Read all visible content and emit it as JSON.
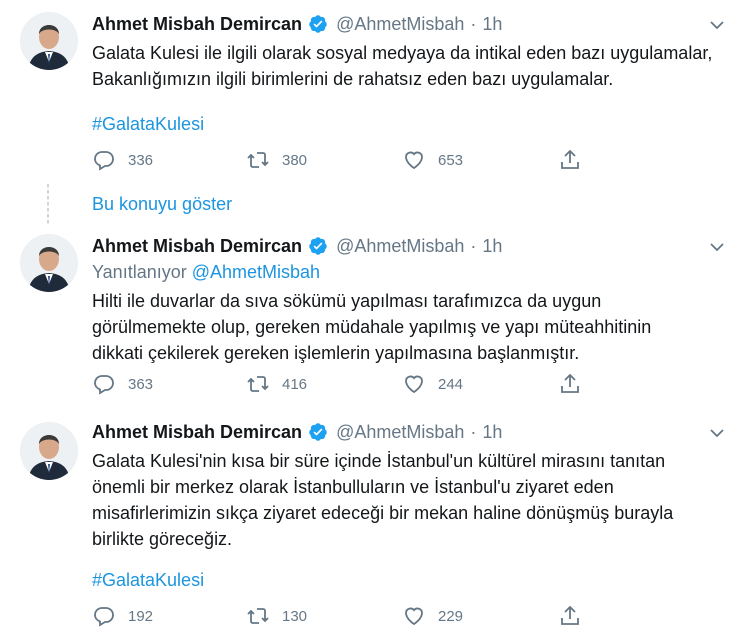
{
  "colors": {
    "accent": "#1b95e0",
    "muted": "#657786",
    "text": "#14171a",
    "verified": "#1da1f2",
    "thread_line": "#ccd6dd"
  },
  "show_thread_label": "Bu konuyu göster",
  "tweets": [
    {
      "author_name": "Ahmet Misbah Demircan",
      "handle": "@AhmetMisbah",
      "separator": "·",
      "time": "1h",
      "text": "Galata Kulesi ile ilgili olarak sosyal medyaya da intikal eden bazı uygulamalar, Bakanlığımızın ilgili birimlerini de rahatsız eden bazı uygulamalar.",
      "hashtag": "#GalataKulesi",
      "replies": "336",
      "retweets": "380",
      "likes": "653"
    },
    {
      "author_name": "Ahmet Misbah Demircan",
      "handle": "@AhmetMisbah",
      "separator": "·",
      "time": "1h",
      "replying_prefix": "Yanıtlanıyor",
      "replying_to": "@AhmetMisbah",
      "text": "Hilti ile duvarlar da sıva sökümü yapılması tarafımızca da uygun görülmemekte olup, gereken müdahale yapılmış ve yapı müteahhitinin dikkati çekilerek gereken işlemlerin yapılmasına başlanmıştır.",
      "replies": "363",
      "retweets": "416",
      "likes": "244"
    },
    {
      "author_name": "Ahmet Misbah Demircan",
      "handle": "@AhmetMisbah",
      "separator": "·",
      "time": "1h",
      "text": "Galata Kulesi'nin kısa bir süre içinde İstanbul'un kültürel mirasını tanıtan önemli bir merkez olarak İstanbulluların ve İstanbul'u ziyaret eden misafirlerimizin sıkça ziyaret edeceği bir mekan haline dönüşmüş burayla birlikte göreceğiz.",
      "hashtag": "#GalataKulesi",
      "replies": "192",
      "retweets": "130",
      "likes": "229"
    }
  ]
}
